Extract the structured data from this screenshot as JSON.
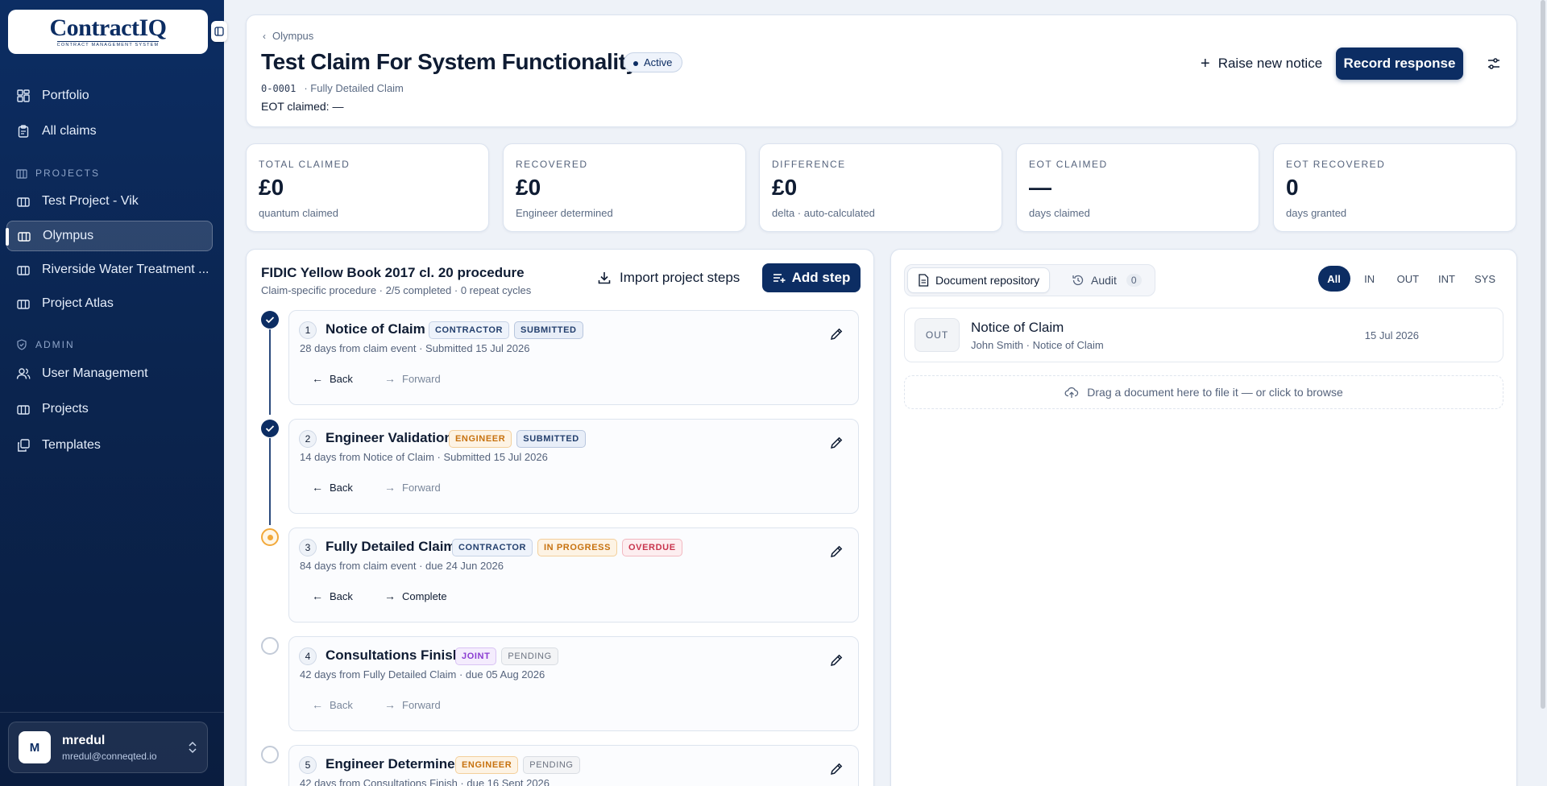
{
  "app": {
    "logo_main": "Contract",
    "logo_iq": "IQ",
    "logo_sub": "CONTRACT MANAGEMENT SYSTEM"
  },
  "sidebar": {
    "items": [
      {
        "label": "Portfolio"
      },
      {
        "label": "All claims"
      }
    ],
    "projects_heading": "PROJECTS",
    "projects": [
      {
        "label": "Test Project - Vik"
      },
      {
        "label": "Olympus"
      },
      {
        "label": "Riverside Water Treatment ..."
      },
      {
        "label": "Project Atlas"
      }
    ],
    "admin_heading": "ADMIN",
    "admin": [
      {
        "label": "User Management"
      },
      {
        "label": "Projects"
      },
      {
        "label": "Templates"
      }
    ],
    "user": {
      "initial": "M",
      "name": "mredul",
      "email": "mredul@conneqted.io"
    }
  },
  "header": {
    "breadcrumb": "Olympus",
    "title": "Test Claim For System Functionality",
    "status": "Active",
    "claim_id": "0-0001",
    "claim_type": "· Fully Detailed Claim",
    "eot_label": "EOT claimed:",
    "eot_value": "—",
    "raise_label": "Raise new notice",
    "record_label": "Record response"
  },
  "stats": [
    {
      "label": "TOTAL CLAIMED",
      "value": "£0",
      "sub": "quantum claimed"
    },
    {
      "label": "RECOVERED",
      "value": "£0",
      "sub": "Engineer determined"
    },
    {
      "label": "DIFFERENCE",
      "value": "£0",
      "sub": "delta · auto-calculated"
    },
    {
      "label": "EOT CLAIMED",
      "value": "—",
      "sub": "days claimed"
    },
    {
      "label": "EOT RECOVERED",
      "value": "0",
      "sub": "days granted"
    }
  ],
  "procedure": {
    "title": "FIDIC Yellow Book 2017 cl. 20 procedure",
    "subtitle": "Claim-specific procedure · 2/5 completed · 0 repeat cycles",
    "import_label": "Import project steps",
    "add_label": "Add step",
    "back_label": "Back",
    "forward_label": "Forward",
    "complete_label": "Complete",
    "steps": [
      {
        "num": "1",
        "title": "Notice of Claim",
        "tags": [
          "CONTRACTOR",
          "SUBMITTED"
        ],
        "desc": "28 days from claim event · Submitted 15 Jul 2026",
        "status": "done"
      },
      {
        "num": "2",
        "title": "Engineer Validation",
        "tags": [
          "ENGINEER",
          "SUBMITTED"
        ],
        "desc": "14 days from Notice of Claim · Submitted 15 Jul 2026",
        "status": "done"
      },
      {
        "num": "3",
        "title": "Fully Detailed Claim",
        "tags": [
          "CONTRACTOR",
          "IN PROGRESS",
          "OVERDUE"
        ],
        "desc": "84 days from claim event · due 24 Jun 2026",
        "status": "progress"
      },
      {
        "num": "4",
        "title": "Consultations Finish",
        "tags": [
          "JOINT",
          "PENDING"
        ],
        "desc": "42 days from Fully Detailed Claim · due 05 Aug 2026",
        "status": "pending"
      },
      {
        "num": "5",
        "title": "Engineer Determines",
        "tags": [
          "ENGINEER",
          "PENDING"
        ],
        "desc": "42 days from Consultations Finish · due 16 Sept 2026",
        "status": "pending"
      }
    ]
  },
  "documents": {
    "tab_repo": "Document repository",
    "tab_audit": "Audit",
    "audit_count": "0",
    "filters": [
      "All",
      "IN",
      "OUT",
      "INT",
      "SYS"
    ],
    "rows": [
      {
        "dir": "OUT",
        "title": "Notice of Claim",
        "sub": "John Smith · Notice of Claim",
        "date": "15 Jul 2026"
      }
    ],
    "dropzone": "Drag a document here to file it — or click to browse"
  }
}
